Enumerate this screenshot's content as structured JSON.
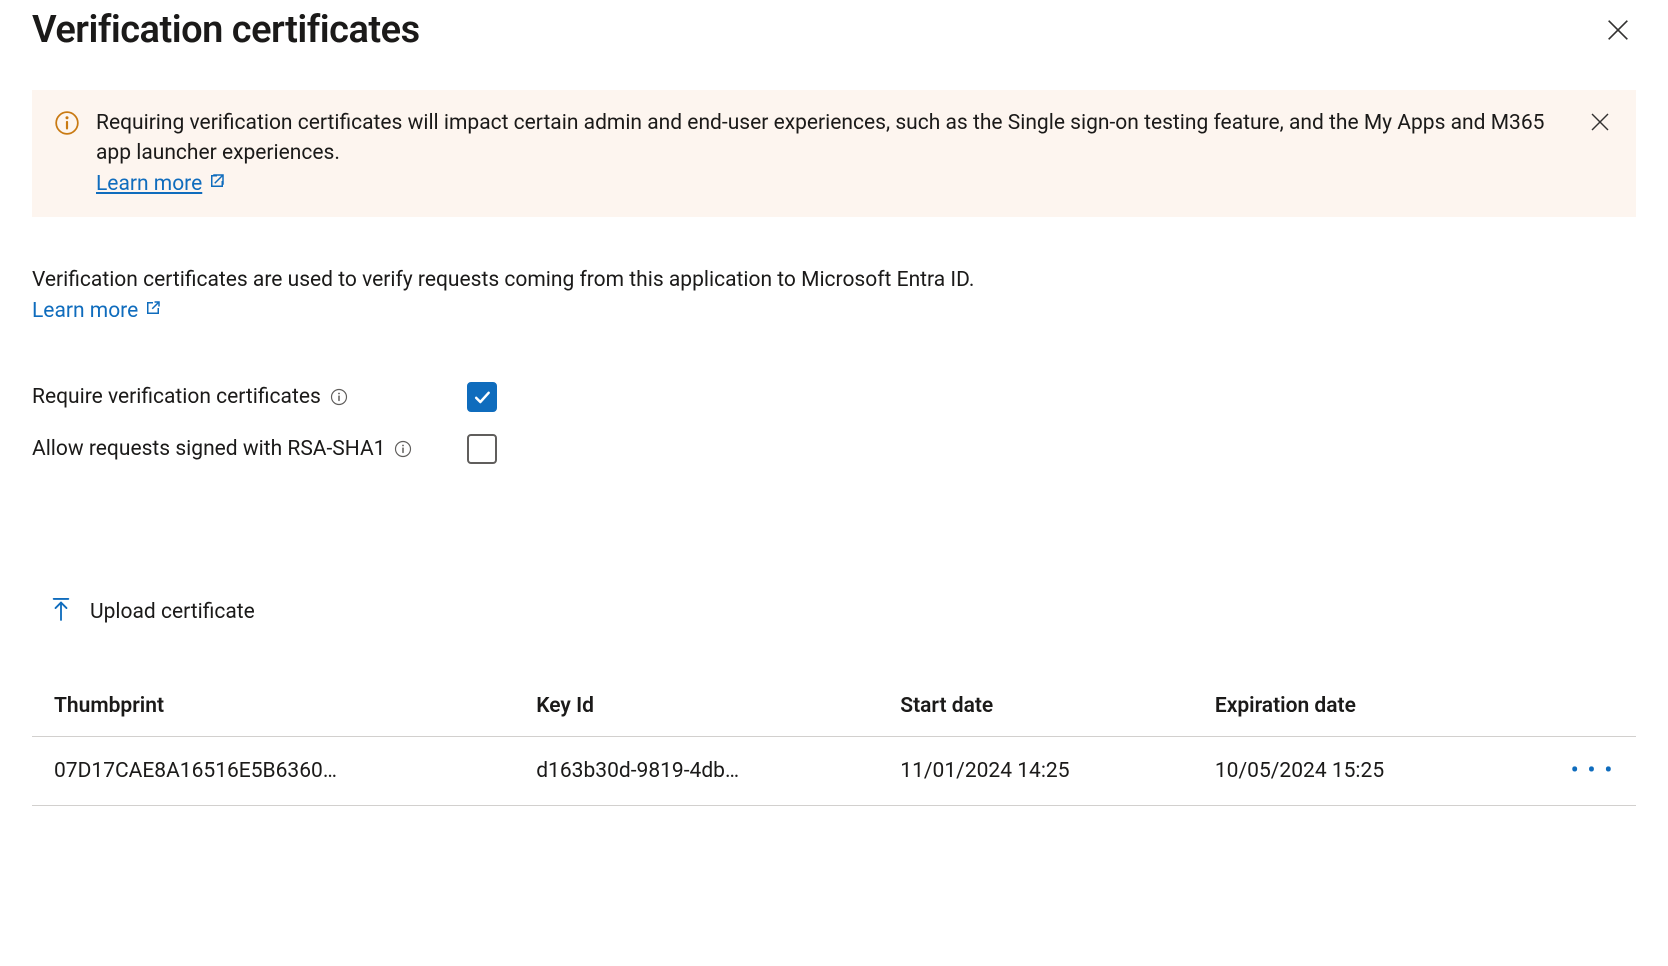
{
  "header": {
    "title": "Verification certificates"
  },
  "banner": {
    "message": "Requiring verification certificates will impact certain admin and end-user experiences, such as the Single sign-on testing feature, and the My Apps and M365 app launcher experiences.",
    "learn_more": "Learn more"
  },
  "description": {
    "text": "Verification certificates are used to verify requests coming from this application to Microsoft Entra ID.",
    "learn_more": "Learn more"
  },
  "settings": {
    "require_label": "Require verification certificates",
    "require_checked": true,
    "allow_rsa_label": "Allow requests signed with RSA-SHA1",
    "allow_rsa_checked": false
  },
  "upload": {
    "label": "Upload certificate"
  },
  "table": {
    "headers": {
      "thumbprint": "Thumbprint",
      "key_id": "Key Id",
      "start_date": "Start date",
      "expiration_date": "Expiration date"
    },
    "rows": [
      {
        "thumbprint": "07D17CAE8A16516E5B6360…",
        "key_id": "d163b30d-9819-4db…",
        "start_date": "11/01/2024 14:25",
        "expiration_date": "10/05/2024 15:25"
      }
    ]
  },
  "colors": {
    "link": "#0f6cbd",
    "banner_bg": "#fdf5ef",
    "info_ring": "#c97a13"
  }
}
